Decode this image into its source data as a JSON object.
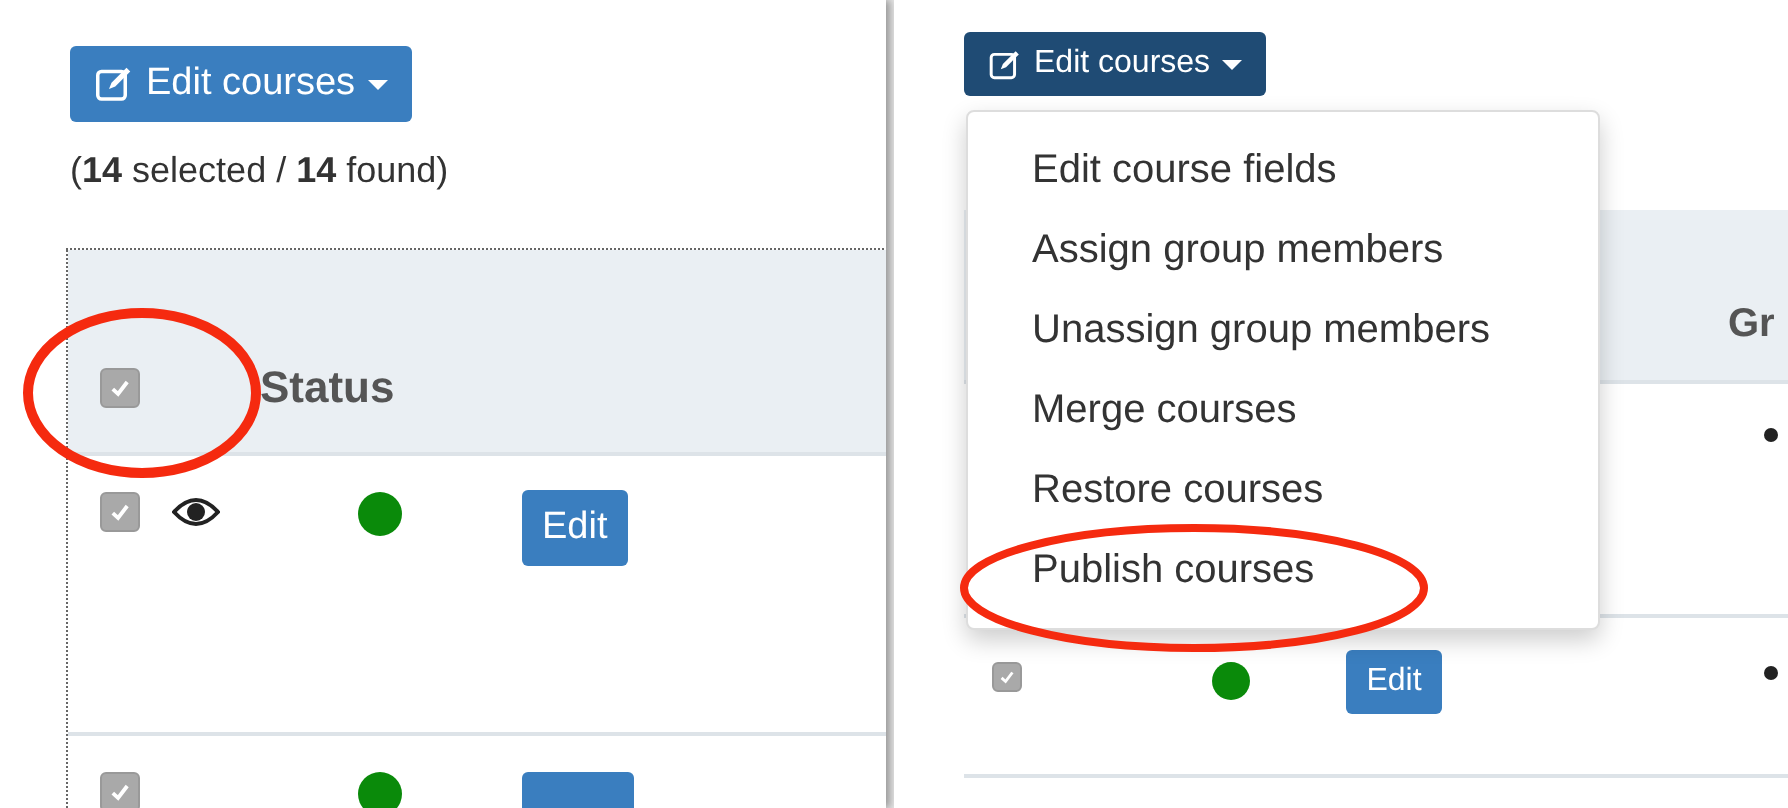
{
  "left_panel": {
    "edit_button": {
      "label": "Edit courses"
    },
    "selection_summary": "(**14** selected / **14** found)",
    "table": {
      "select_all": {
        "checked": true,
        "highlighted": true
      },
      "columns": [
        "Status"
      ],
      "rows": [
        {
          "checked": true,
          "eye_icon": true,
          "edit_label": "Edit"
        },
        {
          "checked": true,
          "eye_icon": false
        }
      ]
    }
  },
  "right_panel": {
    "edit_button": {
      "label": "Edit courses"
    },
    "menu": [
      {
        "label": "Edit course fields",
        "highlighted": false
      },
      {
        "label": "Assign group members",
        "highlighted": false
      },
      {
        "label": "Unassign group members",
        "highlighted": false
      },
      {
        "label": "Merge courses",
        "highlighted": false
      },
      {
        "label": "Restore courses",
        "highlighted": false
      },
      {
        "label": "Publish courses",
        "highlighted": true
      }
    ],
    "table": {
      "columns": [
        "Gr"
      ],
      "rows": [
        {
          "covered": true,
          "group_bullet": true
        },
        {
          "covered": false,
          "checked": true,
          "edit_label": "Edit",
          "group_bullet": true
        }
      ]
    }
  }
}
